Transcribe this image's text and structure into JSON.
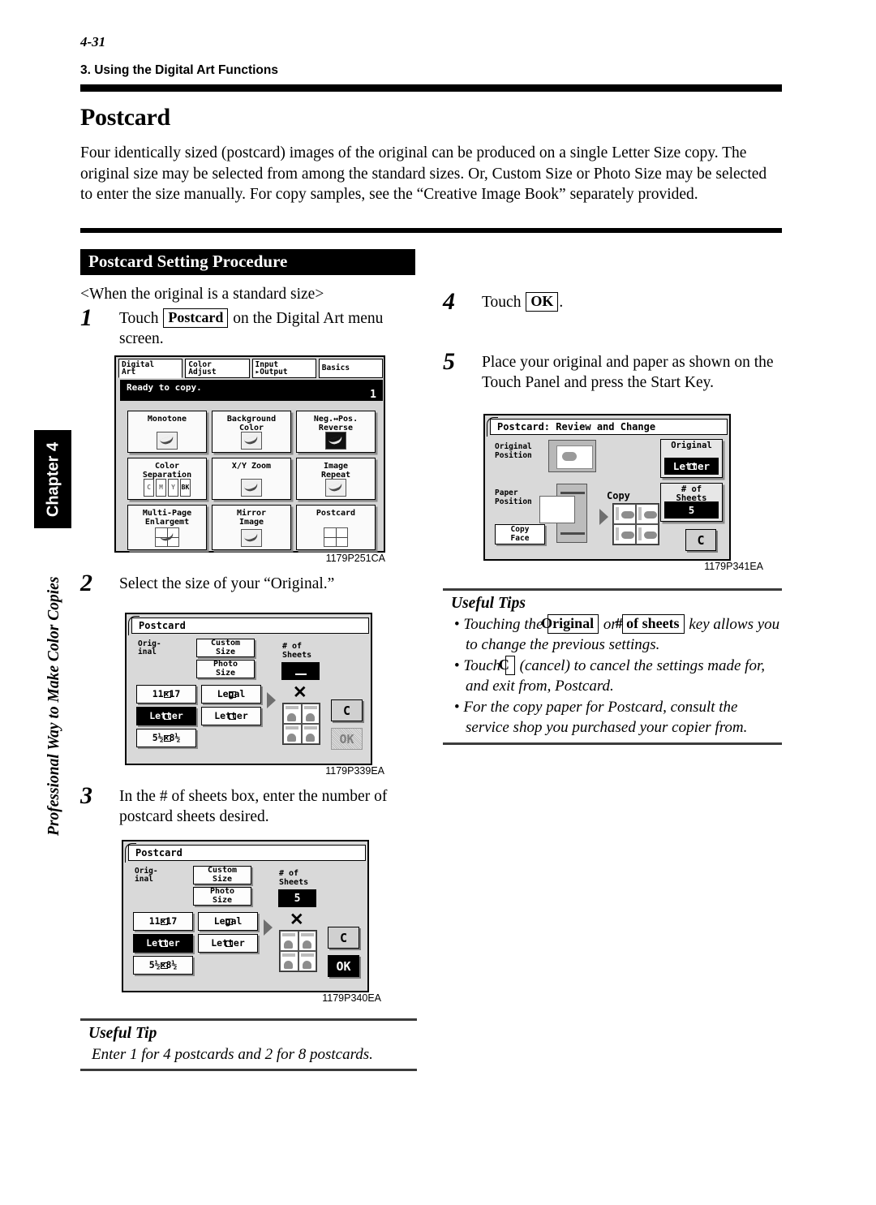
{
  "page": {
    "number": "4-31",
    "section_label": "3. Using the Digital Art Functions",
    "title": "Postcard",
    "intro": "Four identically sized (postcard) images of the original can be produced on a single Letter Size copy. The original size may be selected from among the standard sizes.  Or, Custom Size or Photo Size may be selected to enter the size manually. For copy samples, see the “Creative Image Book” separately provided.",
    "banner": "Postcard Setting Procedure"
  },
  "sidebar": {
    "chapter_tab": "Chapter 4",
    "caption": "Professional Way to Make Color Copies"
  },
  "left_column": {
    "pre_note": "<When the original is a standard size>",
    "step1": {
      "num": "1",
      "text_before": "Touch",
      "key": "Postcard",
      "text_after": "on the Digital Art menu screen."
    },
    "step2": {
      "num": "2",
      "text": "Select the size of your “Original.”"
    },
    "step3": {
      "num": "3",
      "text": "In the # of sheets box, enter the number of postcard sheets desired."
    }
  },
  "right_column": {
    "step4": {
      "num": "4",
      "text_before": "Touch",
      "key": "OK",
      "text_after": "."
    },
    "step5": {
      "num": "5",
      "text": "Place your original and paper as shown on the Touch Panel and press the Start Key."
    }
  },
  "figures": {
    "fig1_caption": "1179P251CA",
    "fig2_caption": "1179P339EA",
    "fig3_caption": "1179P340EA",
    "fig4_caption": "1179P341EA"
  },
  "panel_digital_art": {
    "tabs": [
      {
        "line1": "Digital",
        "line2": "Art",
        "active": true
      },
      {
        "line1": "Color",
        "line2": "Adjust",
        "active": false
      },
      {
        "line1": "Input",
        "line2": "▸Output",
        "active": false
      },
      {
        "line1": "Basics",
        "line2": "",
        "active": false
      }
    ],
    "status": "Ready to copy.",
    "page_indicator": "1",
    "buttons": [
      {
        "line1": "Monotone",
        "line2": ""
      },
      {
        "line1": "Background",
        "line2": "Color"
      },
      {
        "line1": "Neg.↔Pos.",
        "line2": "Reverse"
      },
      {
        "line1": "Color",
        "line2": "Separation"
      },
      {
        "line1": "X/Y Zoom",
        "line2": ""
      },
      {
        "line1": "Image",
        "line2": "Repeat"
      },
      {
        "line1": "Multi-Page",
        "line2": "Enlargemt"
      },
      {
        "line1": "Mirror",
        "line2": "Image"
      },
      {
        "line1": "Postcard",
        "line2": ""
      }
    ],
    "color_sep_channels": [
      "C",
      "M",
      "Y",
      "BK"
    ]
  },
  "panel_postcard_a": {
    "title": "Postcard",
    "label_original": "Orig-\ninal",
    "label_original_l1": "Orig-",
    "label_original_l2": "inal",
    "label_sheets_l1": "# of",
    "label_sheets_l2": "Sheets",
    "btn_custom_l1": "Custom",
    "btn_custom_l2": "Size",
    "btn_photo_l1": "Photo",
    "btn_photo_l2": "Size",
    "sheets_value": "",
    "sizes": [
      {
        "label": "11×17",
        "tag": true,
        "selected": false
      },
      {
        "label": "Legal",
        "tag": true,
        "selected": false
      },
      {
        "label": "Letter",
        "tag": true,
        "selected": true
      },
      {
        "label": "Letter",
        "tag": true,
        "selected": false
      },
      {
        "label": "5½×8½",
        "tag": true,
        "selected": false
      }
    ],
    "multiply_symbol": "✕",
    "btn_c": "C",
    "btn_ok": "OK",
    "ok_enabled": false
  },
  "panel_postcard_b": {
    "title": "Postcard",
    "label_original_l1": "Orig-",
    "label_original_l2": "inal",
    "label_sheets_l1": "# of",
    "label_sheets_l2": "Sheets",
    "btn_custom_l1": "Custom",
    "btn_custom_l2": "Size",
    "btn_photo_l1": "Photo",
    "btn_photo_l2": "Size",
    "sheets_value": "5",
    "sizes": [
      {
        "label": "11×17",
        "tag": true,
        "selected": false
      },
      {
        "label": "Legal",
        "tag": true,
        "selected": false
      },
      {
        "label": "Letter",
        "tag": true,
        "selected": true
      },
      {
        "label": "Letter",
        "tag": true,
        "selected": false
      },
      {
        "label": "5½×8½",
        "tag": true,
        "selected": false
      }
    ],
    "multiply_symbol": "✕",
    "btn_c": "C",
    "btn_ok": "OK",
    "ok_enabled": true
  },
  "panel_review": {
    "title": "Postcard: Review and Change",
    "label_original_position_l1": "Original",
    "label_original_position_l2": "Position",
    "label_paper_position_l1": "Paper",
    "label_paper_position_l2": "Position",
    "label_copy": "Copy",
    "btn_copy_face_l1": "Copy",
    "btn_copy_face_l2": "Face",
    "group_original_caption": "Original",
    "group_original_value": "Letter",
    "group_sheets_caption_l1": "# of",
    "group_sheets_caption_l2": "Sheets",
    "group_sheets_value": "5",
    "btn_c": "C"
  },
  "useful_tip_left": {
    "heading": "Useful Tip",
    "text": "Enter 1 for 4 postcards and 2 for 8 postcards."
  },
  "useful_tips_right": {
    "heading": "Useful Tips",
    "items": [
      {
        "seg1": "Touching the",
        "key1": "Original",
        "seg2": "or",
        "key2": "# of sheets",
        "seg3": "key allows you to change the previous settings."
      },
      {
        "seg1": "Touch",
        "key1": "C",
        "seg2": "(cancel) to cancel the settings made for, and exit from, Postcard."
      },
      {
        "seg1": "For the copy paper for Postcard, consult the service shop you purchased your copier from."
      }
    ]
  },
  "colors": {
    "ink": "#000000",
    "panel_bg": "#d4d4d4",
    "lcd_dark": "#000000",
    "shadow": "#8a8a8a"
  }
}
